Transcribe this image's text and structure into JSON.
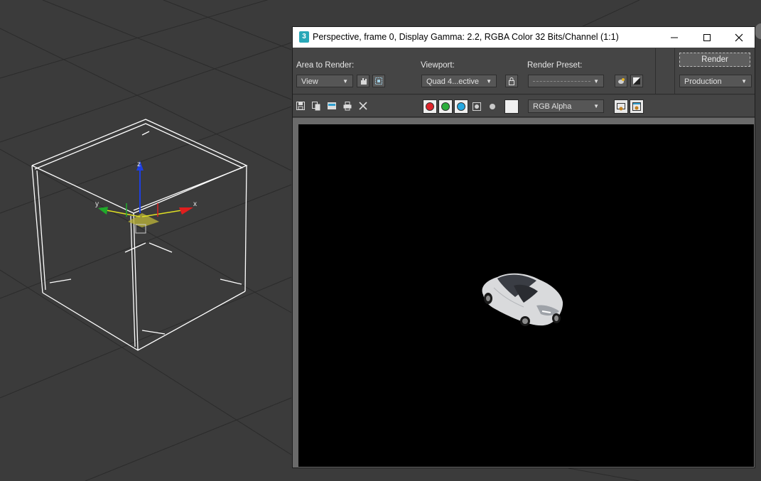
{
  "window": {
    "title": "Perspective, frame 0, Display Gamma: 2.2, RGBA Color 32 Bits/Channel (1:1)",
    "app_icon_text": "3"
  },
  "controls": {
    "area_label": "Area to Render:",
    "area_value": "View",
    "viewport_label": "Viewport:",
    "viewport_value": "Quad 4...ective",
    "preset_label": "Render Preset:",
    "preset_value": "",
    "render_button": "Render",
    "production_value": "Production"
  },
  "toolbar": {
    "channel_value": "RGB Alpha",
    "channels": [
      {
        "name": "red",
        "color": "#e0242b"
      },
      {
        "name": "green",
        "color": "#2cae3c"
      },
      {
        "name": "blue",
        "color": "#27a9e1"
      }
    ]
  },
  "scene": {
    "gizmo_axes": [
      "x",
      "y",
      "z"
    ]
  },
  "colors": {
    "viewport_bg": "#3a3a3a",
    "panel_bg": "#454545",
    "canvas_bg": "#000000"
  }
}
